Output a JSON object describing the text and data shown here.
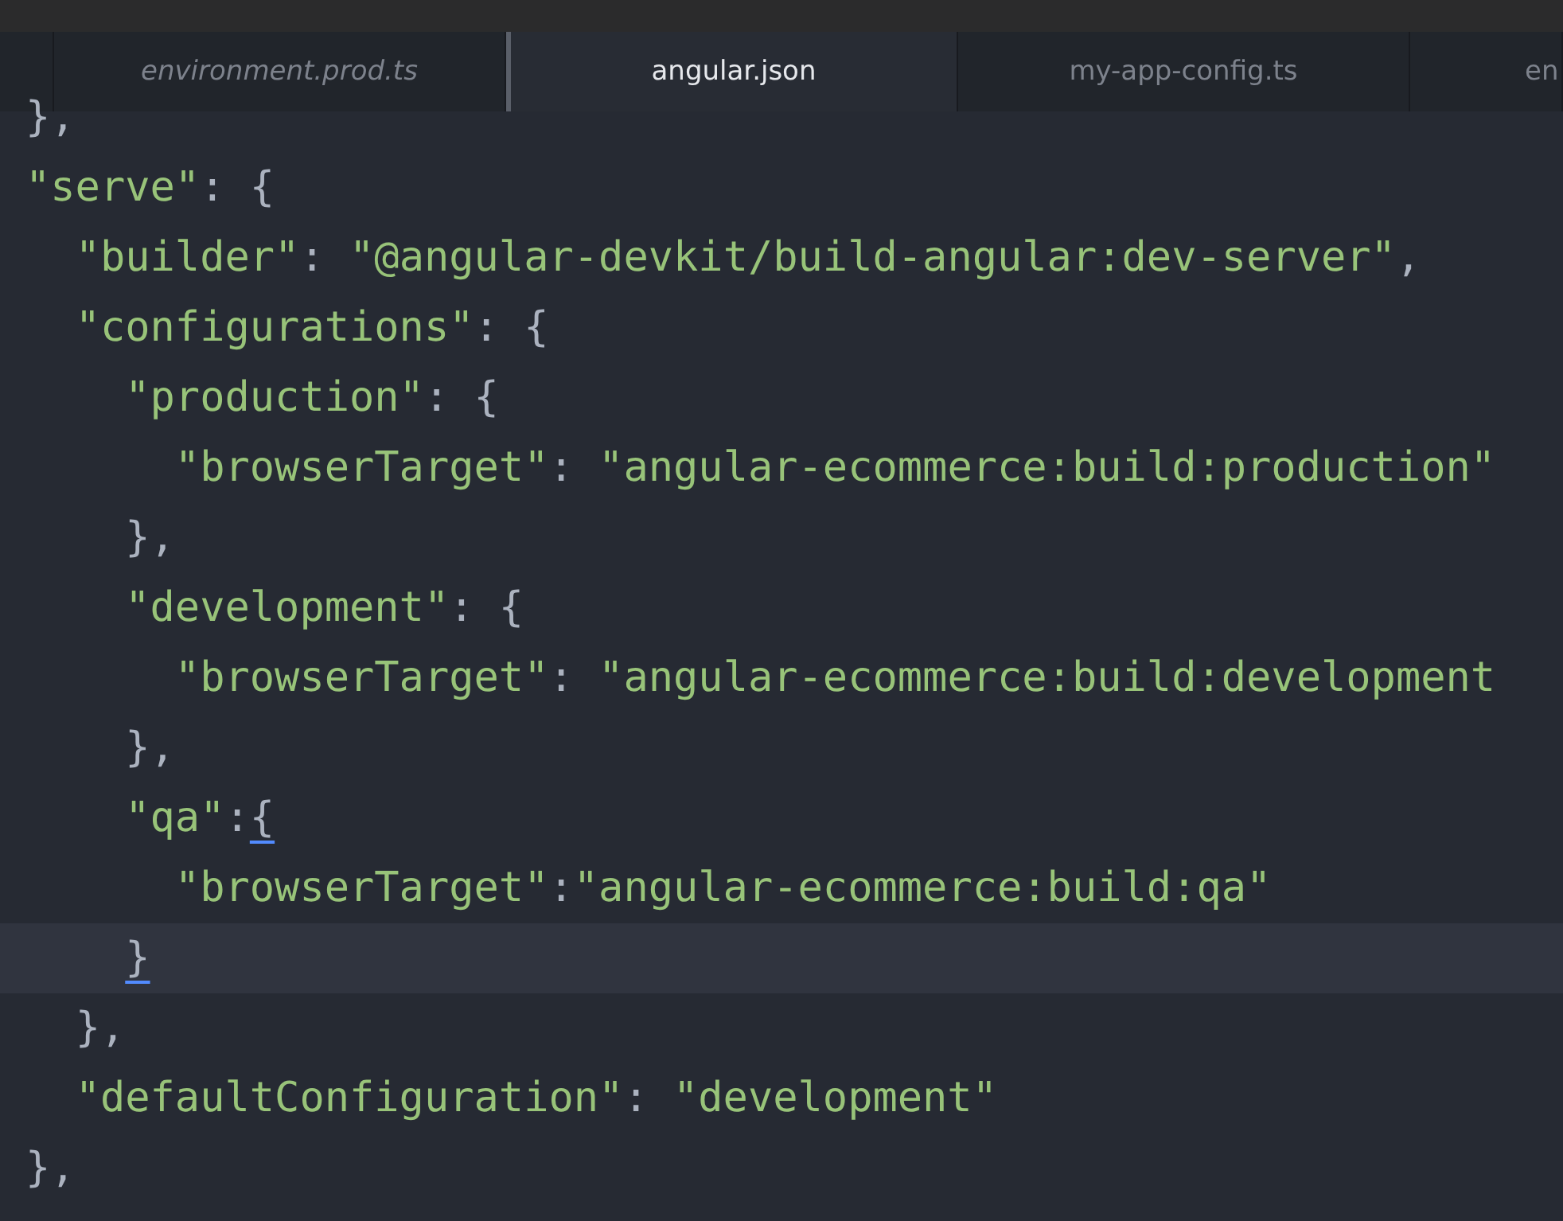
{
  "tabs": [
    {
      "label": "environment.prod.ts",
      "selected": false,
      "italic": true
    },
    {
      "label": "angular.json",
      "selected": true,
      "italic": false
    },
    {
      "label": "my-app-config.ts",
      "selected": false,
      "italic": false
    },
    {
      "label": "en",
      "selected": false,
      "italic": false
    }
  ],
  "editor": {
    "lines": [
      {
        "current": false,
        "tokens": [
          {
            "kind": "punct",
            "text": "},"
          }
        ]
      },
      {
        "current": false,
        "tokens": [
          {
            "kind": "string",
            "text": "\"serve\""
          },
          {
            "kind": "punct",
            "text": ": {"
          }
        ]
      },
      {
        "current": false,
        "tokens": [
          {
            "kind": "string",
            "text": "  \"builder\""
          },
          {
            "kind": "punct",
            "text": ": "
          },
          {
            "kind": "string",
            "text": "\"@angular-devkit/build-angular:dev-server\""
          },
          {
            "kind": "punct",
            "text": ","
          }
        ]
      },
      {
        "current": false,
        "tokens": [
          {
            "kind": "string",
            "text": "  \"configurations\""
          },
          {
            "kind": "punct",
            "text": ": {"
          }
        ]
      },
      {
        "current": false,
        "tokens": [
          {
            "kind": "string",
            "text": "    \"production\""
          },
          {
            "kind": "punct",
            "text": ": {"
          }
        ]
      },
      {
        "current": false,
        "tokens": [
          {
            "kind": "string",
            "text": "      \"browserTarget\""
          },
          {
            "kind": "punct",
            "text": ": "
          },
          {
            "kind": "string",
            "text": "\"angular-ecommerce:build:production\""
          }
        ]
      },
      {
        "current": false,
        "tokens": [
          {
            "kind": "punct",
            "text": "    },"
          }
        ]
      },
      {
        "current": false,
        "tokens": [
          {
            "kind": "string",
            "text": "    \"development\""
          },
          {
            "kind": "punct",
            "text": ": {"
          }
        ]
      },
      {
        "current": false,
        "tokens": [
          {
            "kind": "string",
            "text": "      \"browserTarget\""
          },
          {
            "kind": "punct",
            "text": ": "
          },
          {
            "kind": "string",
            "text": "\"angular-ecommerce:build:development"
          }
        ]
      },
      {
        "current": false,
        "tokens": [
          {
            "kind": "punct",
            "text": "    },"
          }
        ]
      },
      {
        "current": false,
        "tokens": [
          {
            "kind": "string",
            "text": "    \"qa\""
          },
          {
            "kind": "punct",
            "text": ":"
          },
          {
            "kind": "bracket",
            "text": "{",
            "matched": true
          }
        ]
      },
      {
        "current": false,
        "tokens": [
          {
            "kind": "string",
            "text": "      \"browserTarget\""
          },
          {
            "kind": "punct",
            "text": ":"
          },
          {
            "kind": "string",
            "text": "\"angular-ecommerce:build:qa\""
          }
        ]
      },
      {
        "current": true,
        "tokens": [
          {
            "kind": "bracket",
            "text": "    }",
            "matched": true
          }
        ]
      },
      {
        "current": false,
        "tokens": [
          {
            "kind": "punct",
            "text": "  },"
          }
        ]
      },
      {
        "current": false,
        "tokens": [
          {
            "kind": "string",
            "text": "  \"defaultConfiguration\""
          },
          {
            "kind": "punct",
            "text": ": "
          },
          {
            "kind": "string",
            "text": "\"development\""
          }
        ]
      },
      {
        "current": false,
        "tokens": [
          {
            "kind": "punct",
            "text": "},"
          }
        ]
      }
    ]
  }
}
